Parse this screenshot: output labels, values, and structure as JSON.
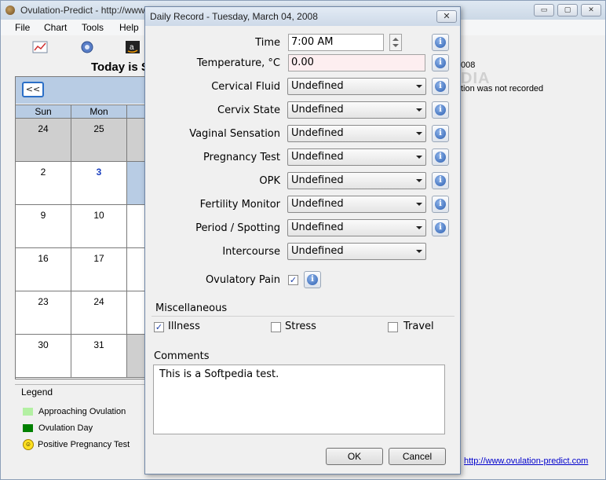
{
  "main_window": {
    "title": "Ovulation-Predict - http://www",
    "controls": {
      "minimize": "▭",
      "restore": "▢",
      "close": "✕"
    }
  },
  "menu": [
    "File",
    "Chart",
    "Tools",
    "Help"
  ],
  "today_label": "Today is S",
  "calendar": {
    "prev_label": "<<",
    "weekdays": [
      "Sun",
      "Mon"
    ],
    "weeks": [
      [
        "24",
        "25"
      ],
      [
        "2",
        "3"
      ],
      [
        "9",
        "10"
      ],
      [
        "16",
        "17"
      ],
      [
        "23",
        "24"
      ],
      [
        "30",
        "31"
      ]
    ],
    "today_day": "3"
  },
  "legend": {
    "title": "Legend",
    "items": [
      {
        "label": "Approaching Ovulation",
        "color": "#b3f0a3"
      },
      {
        "label": "Ovulation Day",
        "color": "#008000"
      },
      {
        "label": "Positive Pregnancy Test",
        "icon": "smiley-icon"
      }
    ]
  },
  "right_panel": {
    "date_fragment": "008",
    "status_text": "tion was not recorded",
    "watermark": "SOFTPEDIA",
    "link": "http://www.ovulation-predict.com"
  },
  "dialog": {
    "title": "Daily Record - Tuesday, March 04, 2008",
    "close": "✕",
    "fields": {
      "time": {
        "label": "Time",
        "value": "7:00 AM"
      },
      "temperature": {
        "label": "Temperature, °C",
        "value": "0.00"
      },
      "cervical_fluid": {
        "label": "Cervical Fluid",
        "value": "Undefined"
      },
      "cervix_state": {
        "label": "Cervix State",
        "value": "Undefined"
      },
      "vaginal_sensation": {
        "label": "Vaginal Sensation",
        "value": "Undefined"
      },
      "pregnancy_test": {
        "label": "Pregnancy Test",
        "value": "Undefined"
      },
      "opk": {
        "label": "OPK",
        "value": "Undefined"
      },
      "fertility_monitor": {
        "label": "Fertility Monitor",
        "value": "Undefined"
      },
      "period_spotting": {
        "label": "Period / Spotting",
        "value": "Undefined"
      },
      "intercourse": {
        "label": "Intercourse",
        "value": "Undefined"
      },
      "ovulatory_pain": {
        "label": "Ovulatory Pain",
        "checked": true
      }
    },
    "miscellaneous": {
      "label": "Miscellaneous",
      "illness": {
        "label": "Illness",
        "checked": true
      },
      "stress": {
        "label": "Stress",
        "checked": false
      },
      "travel": {
        "label": "Travel",
        "checked": false
      }
    },
    "comments": {
      "label": "Comments",
      "value": "This is a Softpedia test."
    },
    "ok_label": "OK",
    "cancel_label": "Cancel",
    "info_glyph": "i",
    "check_glyph": "✓",
    "temperature_bg": "#fdeef0"
  }
}
